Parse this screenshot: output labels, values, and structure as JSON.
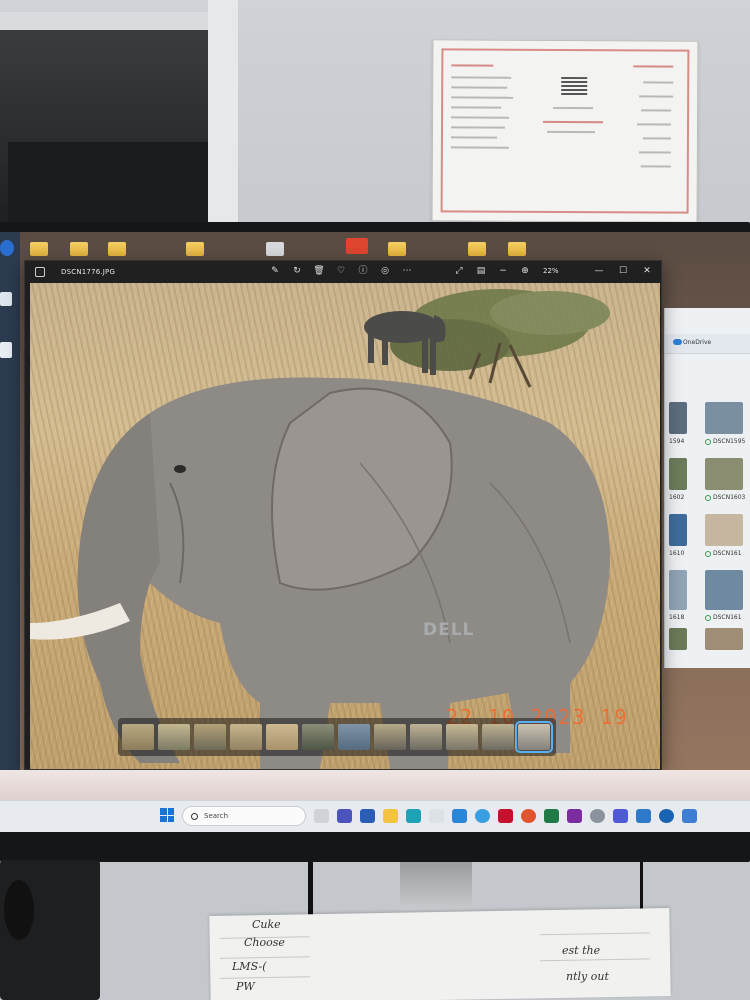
{
  "photos_app": {
    "filename": "DSCN1776.JPG",
    "zoom_label": "22%",
    "photo_timestamp": "22 10 2023 19 06",
    "toolbar_icons": [
      "edit-icon",
      "rotate-icon",
      "delete-icon",
      "favorite-icon",
      "info-icon",
      "copilot-icon",
      "more-icon"
    ],
    "filmstrip_count": 12
  },
  "explorer": {
    "breadcrumb": "OneDrive",
    "captions": [
      {
        "left": "1594",
        "right": "DSCN1595"
      },
      {
        "left": "1602",
        "right": "DSCN1603"
      },
      {
        "left": "1610",
        "right": "DSCN161"
      },
      {
        "left": "1618",
        "right": "DSCN161"
      }
    ]
  },
  "taskbar": {
    "search_placeholder": "Search"
  },
  "monitor": {
    "brand": "DELL"
  },
  "desk_notes": {
    "note1": "Cuke",
    "note2": "Choose",
    "note3": "LMS-(",
    "note4": "PW",
    "note5": "est the",
    "note6": "ntly out"
  },
  "colors": {
    "timestamp": "#f26a2e",
    "filmstrip_active": "#5ab0f0",
    "taskbar_bg": "#e7eaee"
  }
}
